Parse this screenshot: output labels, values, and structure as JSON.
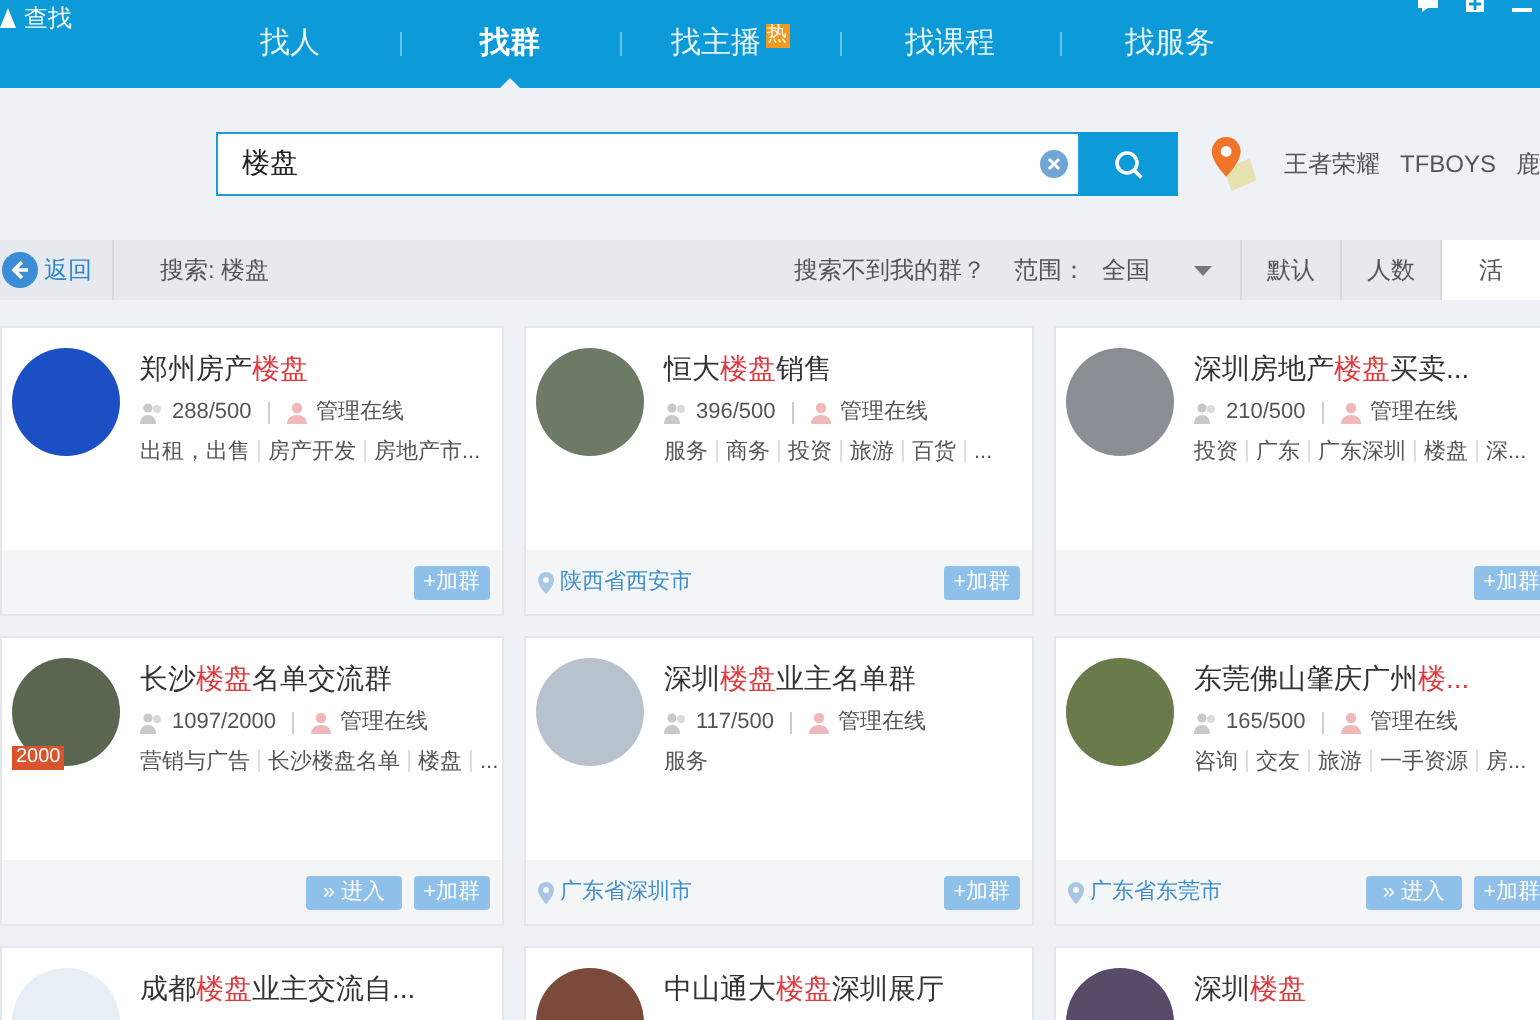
{
  "window": {
    "title": "查找"
  },
  "tabs": [
    {
      "label": "找人",
      "selected": false
    },
    {
      "label": "找群",
      "selected": true
    },
    {
      "label": "找主播",
      "selected": false,
      "badge": "热"
    },
    {
      "label": "找课程",
      "selected": false
    },
    {
      "label": "找服务",
      "selected": false
    }
  ],
  "search": {
    "value": "楼盘"
  },
  "hot_tags": [
    "王者荣耀",
    "TFBOYS",
    "鹿"
  ],
  "filter_bar": {
    "back": "返回",
    "query": "搜索: 楼盘",
    "not_found": "搜索不到我的群？",
    "scope_label": "范围：",
    "scope_value": "全国",
    "sort_tabs": [
      {
        "label": "默认",
        "selected": false
      },
      {
        "label": "人数",
        "selected": false
      },
      {
        "label": "活",
        "selected": true
      }
    ]
  },
  "cards": [
    {
      "title": [
        {
          "text": "郑州房产",
          "highlight": false
        },
        {
          "text": "楼盘",
          "highlight": true
        }
      ],
      "members": "288/500",
      "admin": "管理在线",
      "tags": [
        "出租，出售",
        "房产开发",
        "房地产市..."
      ],
      "join": "+加群"
    },
    {
      "title": [
        {
          "text": "恒大",
          "highlight": false
        },
        {
          "text": "楼盘",
          "highlight": true
        },
        {
          "text": "销售",
          "highlight": false
        }
      ],
      "members": "396/500",
      "admin": "管理在线",
      "tags": [
        "服务",
        "商务",
        "投资",
        "旅游",
        "百货",
        "..."
      ],
      "location": "陕西省西安市",
      "join": "+加群"
    },
    {
      "title": [
        {
          "text": "深圳房地产",
          "highlight": false
        },
        {
          "text": "楼盘",
          "highlight": true
        },
        {
          "text": "买卖...",
          "highlight": false
        }
      ],
      "members": "210/500",
      "admin": "管理在线",
      "tags": [
        "投资",
        "广东",
        "广东深圳",
        "楼盘",
        "深..."
      ],
      "join": "+加群"
    },
    {
      "title": [
        {
          "text": "长沙",
          "highlight": false
        },
        {
          "text": "楼盘",
          "highlight": true
        },
        {
          "text": "名单交流群",
          "highlight": false
        }
      ],
      "avatar_badge": "2000",
      "members": "1097/2000",
      "admin": "管理在线",
      "tags": [
        "营销与广告",
        "长沙楼盘名单",
        "楼盘",
        "..."
      ],
      "enter": "» 进入",
      "join": "+加群"
    },
    {
      "title": [
        {
          "text": "深圳",
          "highlight": false
        },
        {
          "text": "楼盘",
          "highlight": true
        },
        {
          "text": "业主名单群",
          "highlight": false
        }
      ],
      "members": "117/500",
      "admin": "管理在线",
      "tags": [
        "服务"
      ],
      "location": "广东省深圳市",
      "join": "+加群"
    },
    {
      "title": [
        {
          "text": "东莞佛山肇庆广州",
          "highlight": false
        },
        {
          "text": "楼...",
          "highlight": true
        }
      ],
      "members": "165/500",
      "admin": "管理在线",
      "tags": [
        "咨询",
        "交友",
        "旅游",
        "一手资源",
        "房..."
      ],
      "location": "广东省东莞市",
      "enter": "» 进入",
      "join": "+加群"
    },
    {
      "title": [
        {
          "text": "成都",
          "highlight": false
        },
        {
          "text": "楼盘",
          "highlight": true
        },
        {
          "text": "业主交流自...",
          "highlight": false
        }
      ]
    },
    {
      "title": [
        {
          "text": "中山通大",
          "highlight": false
        },
        {
          "text": "楼盘",
          "highlight": true
        },
        {
          "text": "深圳展厅",
          "highlight": false
        }
      ]
    },
    {
      "title": [
        {
          "text": "深圳",
          "highlight": false
        },
        {
          "text": "楼盘",
          "highlight": true
        }
      ]
    }
  ]
}
